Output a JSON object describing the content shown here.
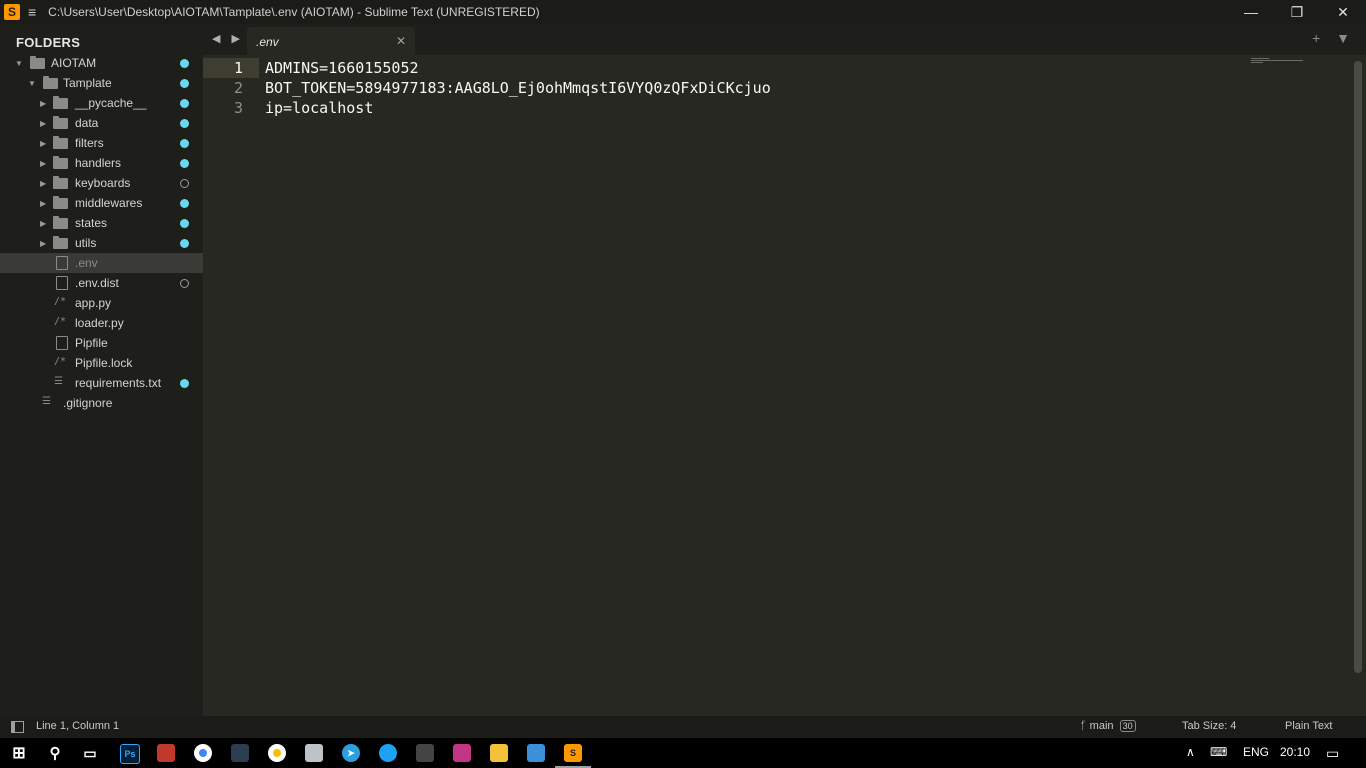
{
  "window": {
    "title": "C:\\Users\\User\\Desktop\\AIOTAM\\Tamplate\\.env (AIOTAM) - Sublime Text (UNREGISTERED)",
    "minimize": "—",
    "maximize": "❐",
    "close": "✕"
  },
  "sidebar": {
    "heading": "FOLDERS",
    "root": "AIOTAM",
    "sub": "Tamplate",
    "folders": [
      "__pycache__",
      "data",
      "filters",
      "handlers",
      "keyboards",
      "middlewares",
      "states",
      "utils"
    ],
    "files": [
      ".env",
      ".env.dist",
      "app.py",
      "loader.py",
      "Pipfile",
      "Pipfile.lock",
      "requirements.txt"
    ],
    "root_file": ".gitignore"
  },
  "tabs": {
    "nav": "◀ ▶",
    "active": ".env",
    "close": "✕",
    "right_controls": "+ ▼"
  },
  "editor": {
    "line_numbers": [
      "1",
      "2",
      "3"
    ],
    "lines": [
      "ADMINS=1660155052",
      "BOT_TOKEN=5894977183:AAG8LO_Ej0ohMmqstI6VYQ0zQFxDiCKcjuo",
      "ip=localhost"
    ]
  },
  "statusbar": {
    "position": "Line 1, Column 1",
    "branch": "main",
    "branch_count": "30",
    "tab_size": "Tab Size: 4",
    "syntax": "Plain Text"
  },
  "taskbar": {
    "language": "ENG",
    "time": "20:10"
  }
}
